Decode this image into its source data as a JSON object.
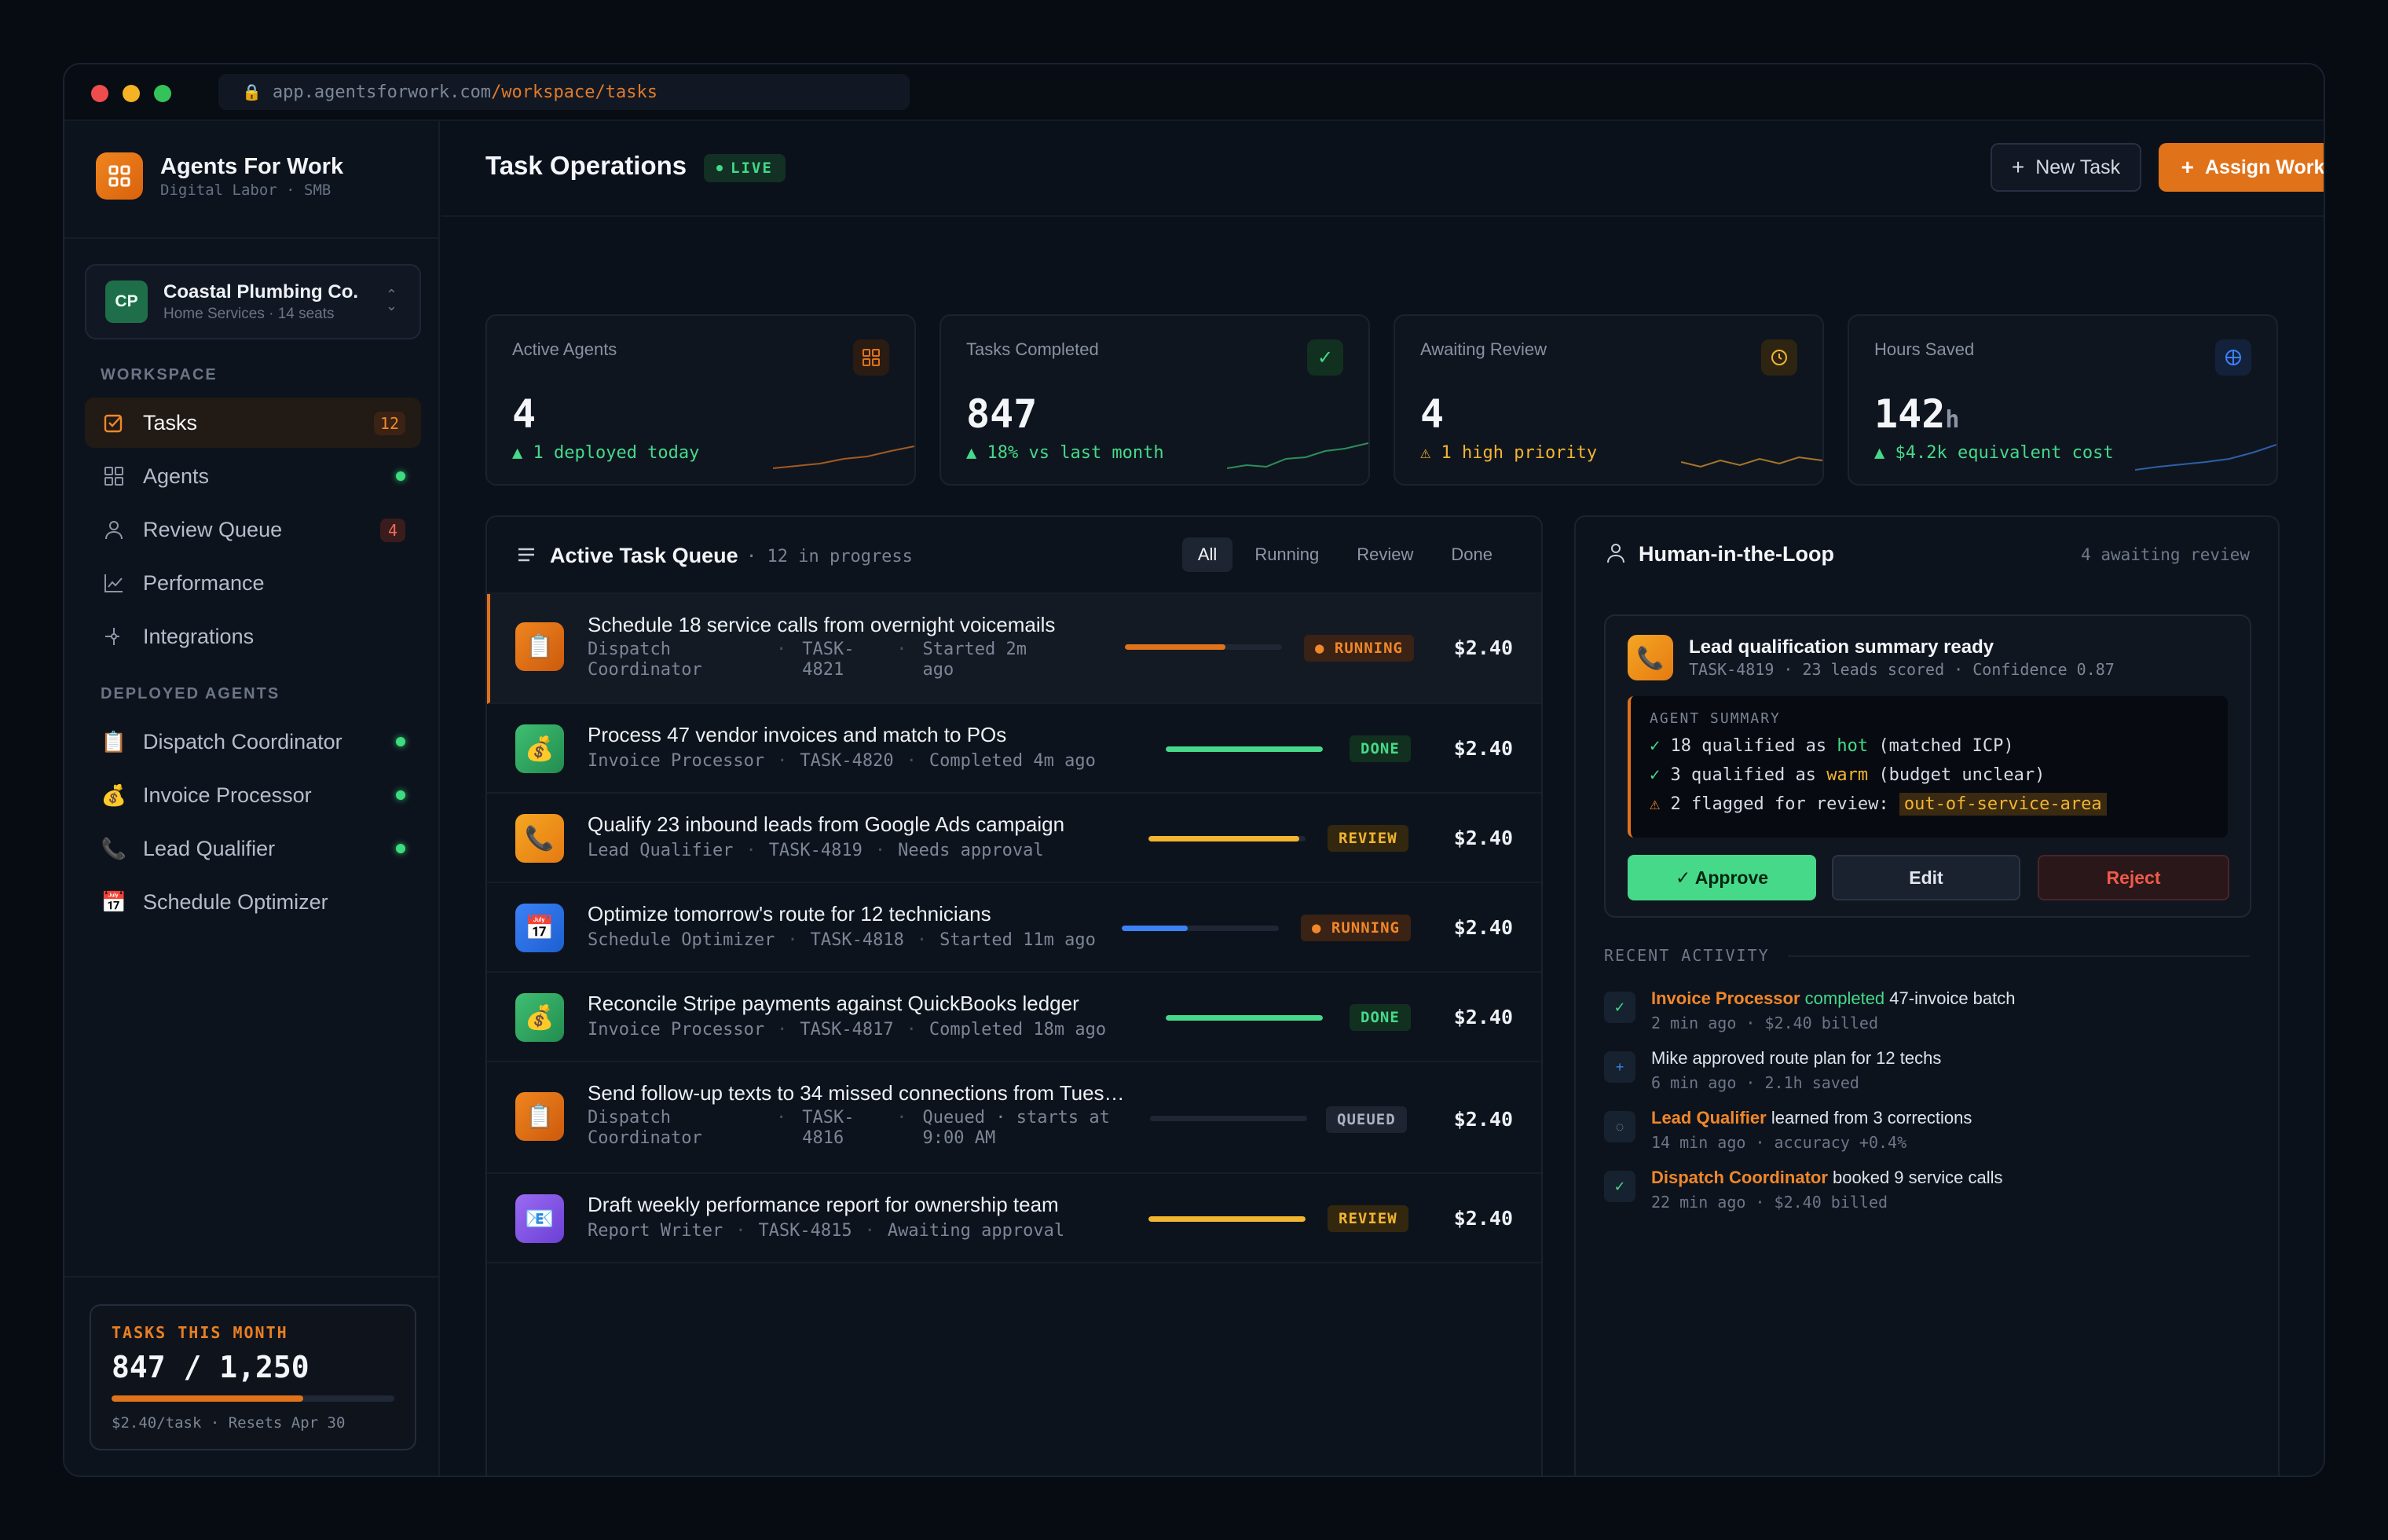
{
  "browser": {
    "url_host": "app.agentsforwork.com",
    "url_path": "/workspace/tasks"
  },
  "brand": {
    "title": "Agents For Work",
    "subtitle": "Digital Labor · SMB"
  },
  "org": {
    "initials": "CP",
    "name": "Coastal Plumbing Co.",
    "subtitle": "Home Services · 14 seats"
  },
  "sidebar": {
    "workspace_label": "WORKSPACE",
    "workspace_items": [
      {
        "label": "Tasks",
        "icon": "tasks-icon",
        "badge": "12"
      },
      {
        "label": "Agents",
        "icon": "grid-icon",
        "status": "online"
      },
      {
        "label": "Review Queue",
        "icon": "user-icon",
        "badge": "4"
      },
      {
        "label": "Performance",
        "icon": "chart-icon"
      },
      {
        "label": "Integrations",
        "icon": "plug-icon"
      }
    ],
    "agents_label": "DEPLOYED AGENTS",
    "agents": [
      {
        "label": "Dispatch Coordinator",
        "icon": "📋",
        "status": "online"
      },
      {
        "label": "Invoice Processor",
        "icon": "💰",
        "status": "online"
      },
      {
        "label": "Lead Qualifier",
        "icon": "📞",
        "status": "online"
      },
      {
        "label": "Schedule Optimizer",
        "icon": "📅"
      }
    ],
    "usage": {
      "label": "TASKS THIS MONTH",
      "value": "847 / 1,250",
      "fraction": 0.678,
      "sub": "$2.40/task · Resets Apr 30"
    }
  },
  "header": {
    "title": "Task Operations",
    "live_label": "LIVE",
    "new_task": "New Task",
    "assign_work": "Assign Work"
  },
  "stats": [
    {
      "label": "Active Agents",
      "value": "4",
      "unit": "",
      "delta": "▲ 1 deployed today",
      "tone": "#46d98a",
      "icon_color": "#e0721a"
    },
    {
      "label": "Tasks Completed",
      "value": "847",
      "unit": "",
      "delta": "▲ 18% vs last month",
      "tone": "#46d98a",
      "icon_color": "#46d98a"
    },
    {
      "label": "Awaiting Review",
      "value": "4",
      "unit": "",
      "delta": "⚠ 1 high priority",
      "tone": "#f2b530",
      "icon_color": "#f2b530"
    },
    {
      "label": "Hours Saved",
      "value": "142",
      "unit": "h",
      "delta": "▲ $4.2k equivalent cost",
      "tone": "#46d98a",
      "icon_color": "#3b82f6"
    }
  ],
  "queue": {
    "title": "Active Task Queue",
    "count": "· 12 in progress",
    "tabs": [
      "All",
      "Running",
      "Review",
      "Done"
    ],
    "rows": [
      {
        "title": "Schedule 18 service calls from overnight voicemails",
        "agent": "Dispatch Coordinator",
        "agent_l1": "Dispatch",
        "agent_l2": "Coordinator",
        "task": "TASK-4821",
        "task_l1": "TASK-",
        "task_l2": "4821",
        "when": "Started 2m ago",
        "when_l1": "Started 2m",
        "when_l2": "ago",
        "status": "RUNNING",
        "progress": 0.64,
        "price": "$2.40",
        "icon": "📋"
      },
      {
        "title": "Process 47 vendor invoices and match to POs",
        "agent": "Invoice Processor",
        "task": "TASK-4820",
        "when": "Completed 4m ago",
        "status": "DONE",
        "progress": 1.0,
        "price": "$2.40",
        "icon": "💰"
      },
      {
        "title": "Qualify 23 inbound leads from Google Ads campaign",
        "agent": "Lead Qualifier",
        "task": "TASK-4819",
        "when": "Needs approval",
        "status": "REVIEW",
        "progress": 0.96,
        "price": "$2.40",
        "icon": "📞"
      },
      {
        "title": "Optimize tomorrow's route for 12 technicians",
        "agent": "Schedule Optimizer",
        "task": "TASK-4818",
        "when": "Started 11m ago",
        "status": "RUNNING",
        "progress": 0.42,
        "price": "$2.40",
        "icon": "📅"
      },
      {
        "title": "Reconcile Stripe payments against QuickBooks ledger",
        "agent": "Invoice Processor",
        "task": "TASK-4817",
        "when": "Completed 18m ago",
        "status": "DONE",
        "progress": 1.0,
        "price": "$2.40",
        "icon": "💰"
      },
      {
        "title": "Send follow-up texts to 34 missed connections from Tues…",
        "agent": "Dispatch Coordinator",
        "agent_l1": "Dispatch",
        "agent_l2": "Coordinator",
        "task": "TASK-4816",
        "task_l1": "TASK-",
        "task_l2": "4816",
        "when": "Queued · starts at 9:00 AM",
        "when_l1": "Queued · starts at",
        "when_l2": "9:00 AM",
        "status": "QUEUED",
        "progress": 0.0,
        "price": "$2.40",
        "icon": "📋"
      },
      {
        "title": "Draft weekly performance report for ownership team",
        "agent": "Report Writer",
        "task": "TASK-4815",
        "when": "Awaiting approval",
        "status": "REVIEW",
        "progress": 1.0,
        "price": "$2.40",
        "icon": "📧"
      }
    ]
  },
  "hitl": {
    "title": "Human-in-the-Loop",
    "count": "4 awaiting review",
    "card": {
      "title": "Lead qualification summary ready",
      "sub": "TASK-4819 · 23 leads scored · Confidence 0.87",
      "summary_label": "AGENT SUMMARY",
      "l1": {
        "mark": "✓",
        "a": "18 qualified as ",
        "hl": "hot",
        "b": " (matched ICP)"
      },
      "l2": {
        "mark": "✓",
        "a": "3 qualified as ",
        "hl": "warm",
        "b": " (budget unclear)"
      },
      "l3": {
        "mark": "⚠",
        "a": "2 flagged for review: ",
        "hl": "out-of-service-area"
      },
      "approve": "✓ Approve",
      "edit": "Edit",
      "reject": "Reject"
    },
    "recent_label": "RECENT ACTIVITY",
    "activity": [
      {
        "icon": "✓",
        "lead": "Invoice Processor",
        "verb": " completed",
        "rest": " 47-invoice batch",
        "meta": "2 min ago · $2.40 billed"
      },
      {
        "icon": "+",
        "lead": "",
        "verb": "",
        "rest": "Mike approved route plan for 12 techs",
        "meta": "6 min ago · 2.1h saved"
      },
      {
        "icon": "◌",
        "lead": "Lead Qualifier",
        "verb": "",
        "rest": " learned from 3 corrections",
        "meta": "14 min ago · accuracy +0.4%"
      },
      {
        "icon": "✓",
        "lead": "Dispatch Coordinator",
        "verb": "",
        "rest": " booked 9 service calls",
        "meta": "22 min ago · $2.40 billed"
      }
    ]
  }
}
